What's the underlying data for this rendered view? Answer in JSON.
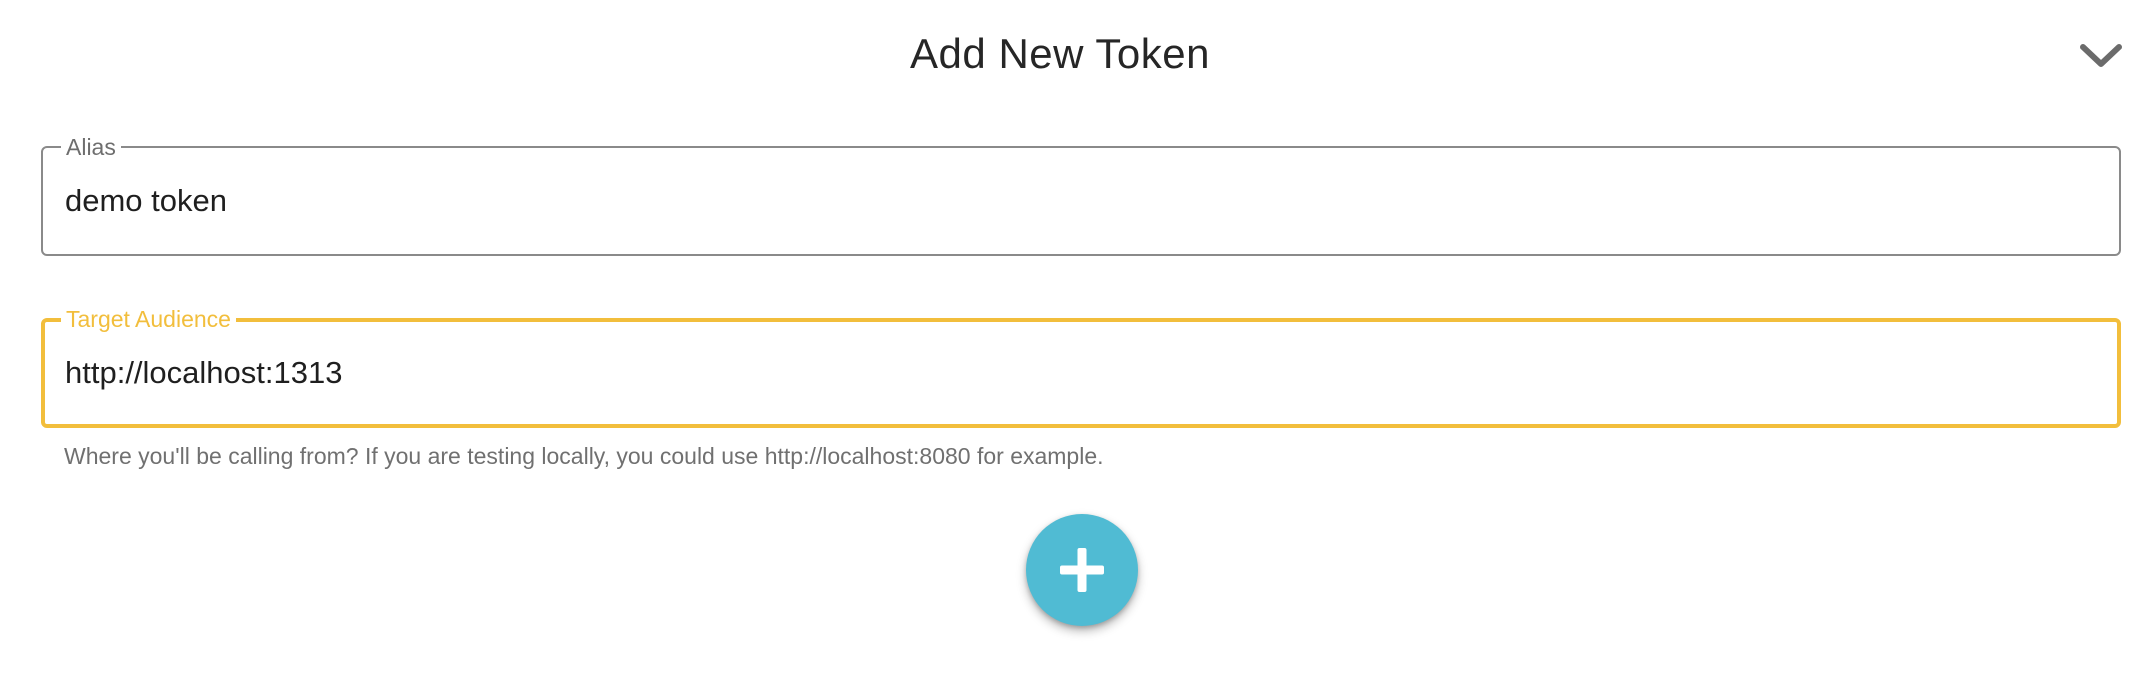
{
  "header": {
    "title": "Add New Token",
    "collapse_icon": "chevron-down-icon"
  },
  "form": {
    "alias": {
      "label": "Alias",
      "value": "demo token",
      "border_color": "#8a8a8a"
    },
    "target_audience": {
      "label": "Target Audience",
      "value": "http://localhost:1313",
      "helper_text": "Where you'll be calling from? If you are testing locally, you could use http://localhost:8080 for example.",
      "focused": true,
      "accent_color": "#f2be3c"
    }
  },
  "add_button": {
    "icon": "plus-icon",
    "color": "#50bbd3"
  }
}
